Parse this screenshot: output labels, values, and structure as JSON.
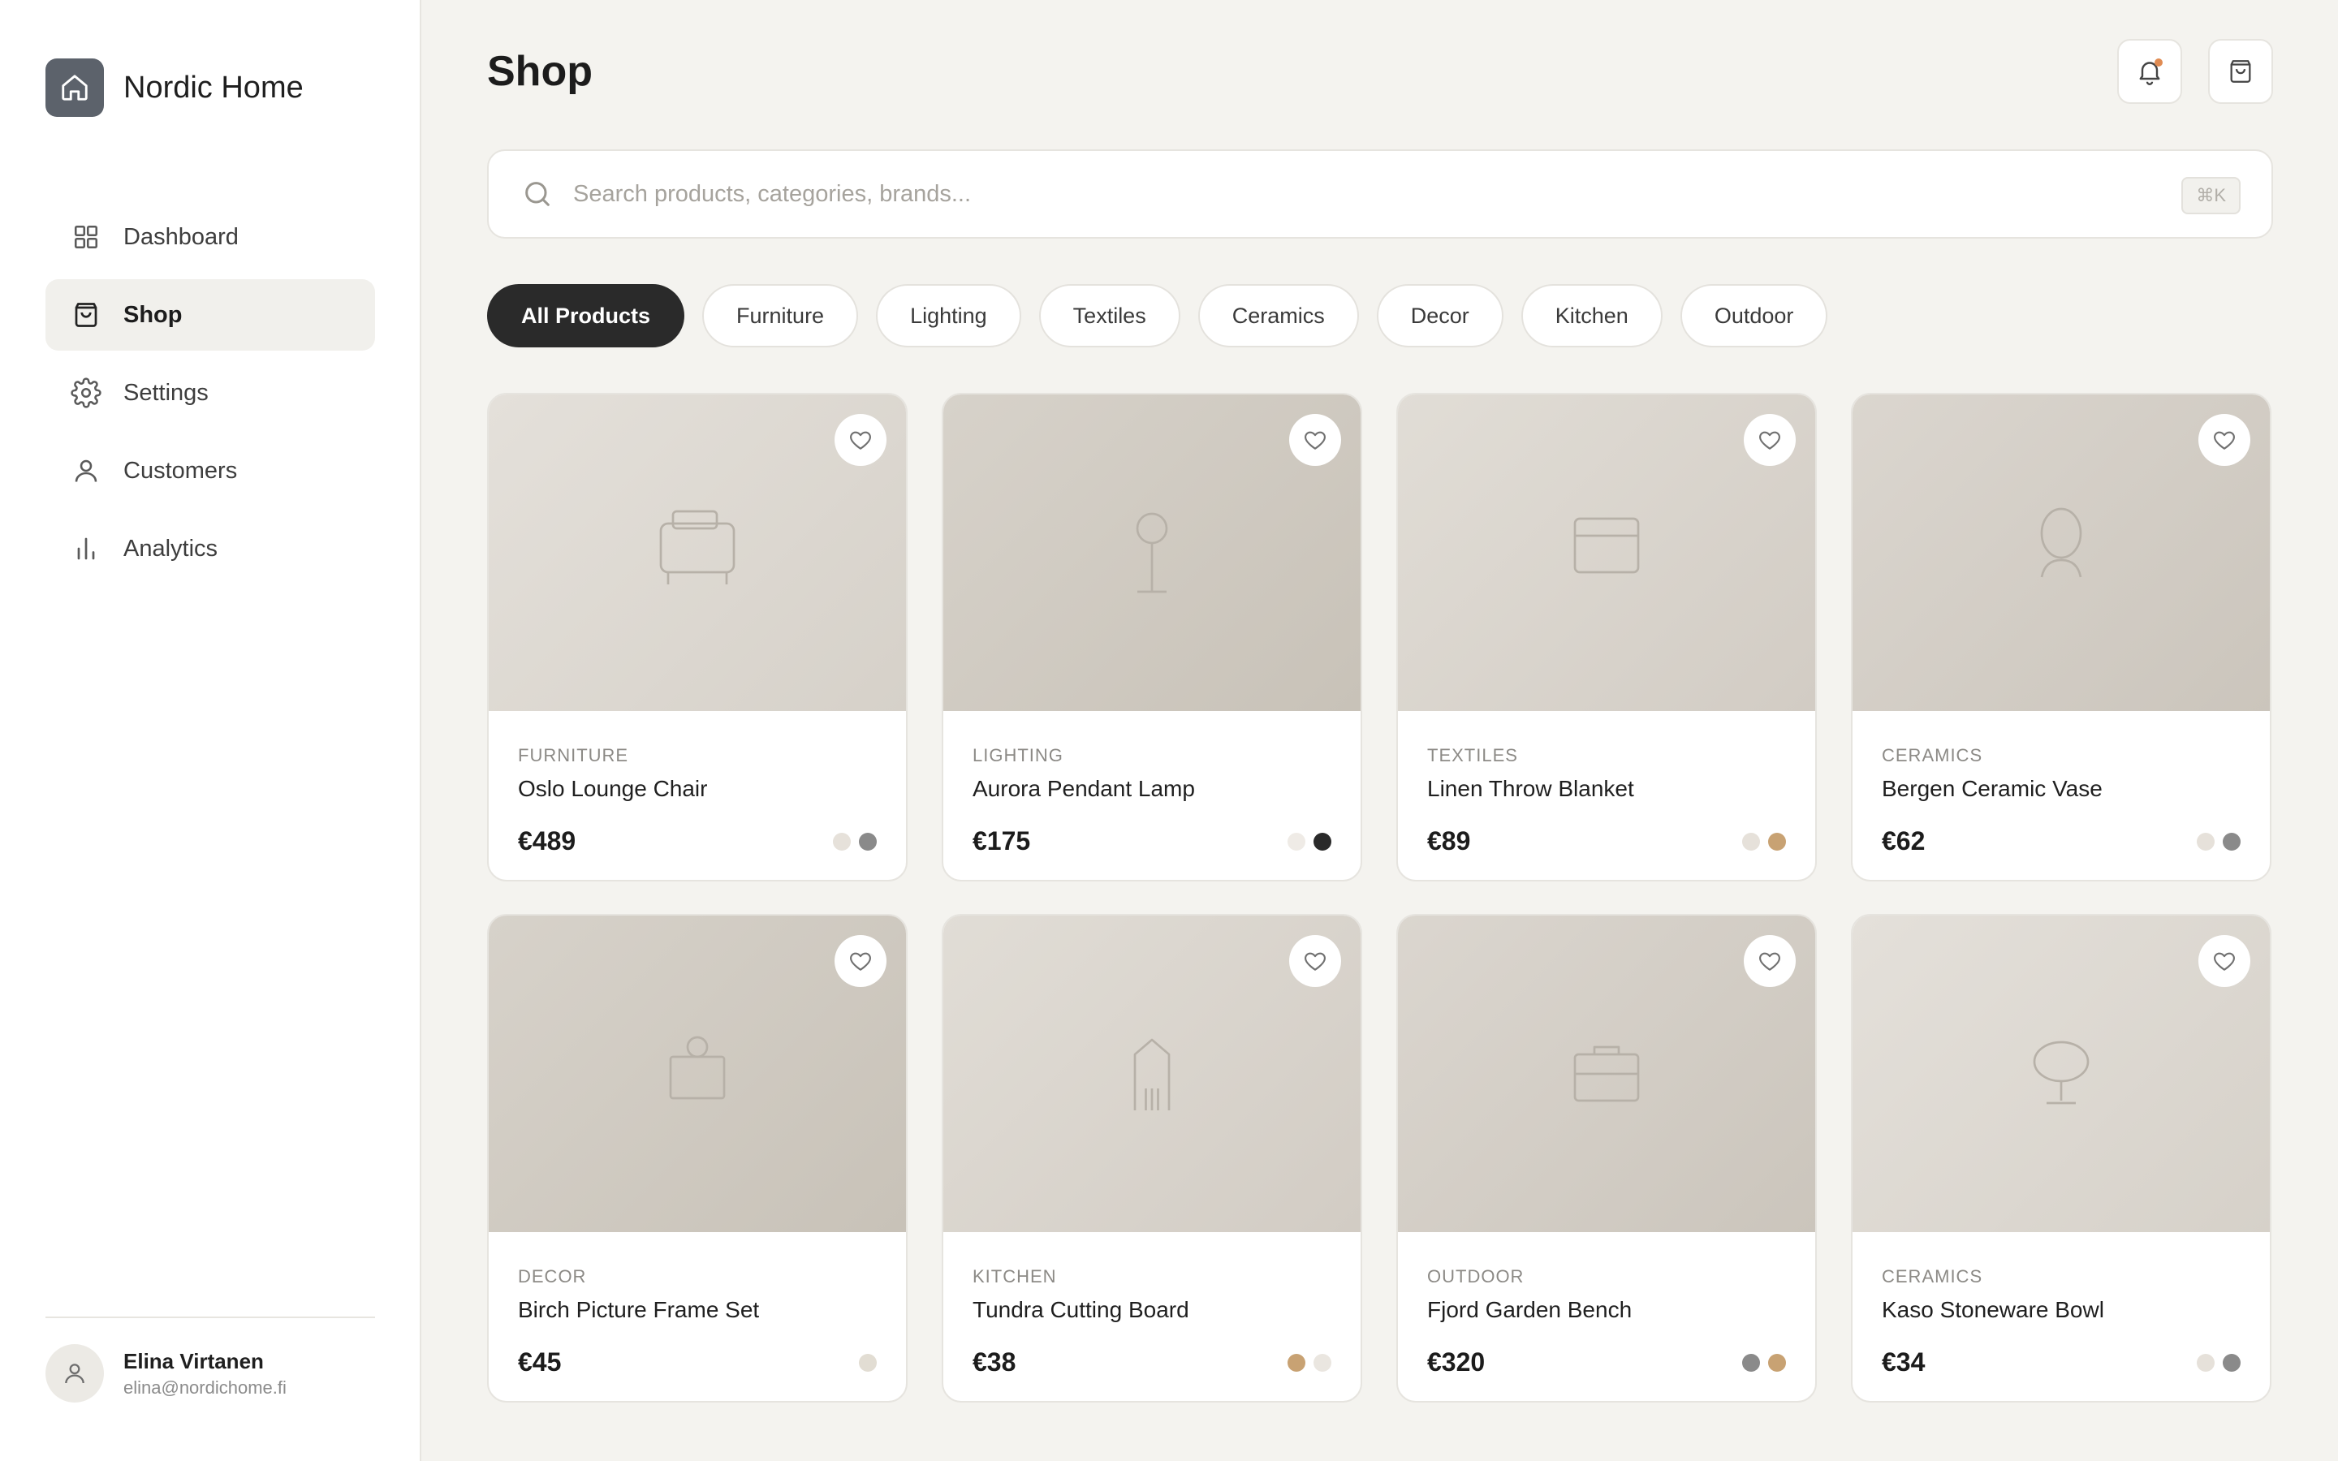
{
  "brand": {
    "name": "Nordic Home",
    "icon": "home-icon"
  },
  "nav": [
    {
      "label": "Dashboard",
      "icon": "grid-icon",
      "active": false
    },
    {
      "label": "Shop",
      "icon": "shopping-bag-icon",
      "active": true
    },
    {
      "label": "Settings",
      "icon": "gear-icon",
      "active": false
    },
    {
      "label": "Customers",
      "icon": "user-icon",
      "active": false
    },
    {
      "label": "Analytics",
      "icon": "bar-chart-icon",
      "active": false
    }
  ],
  "user": {
    "name": "Elina Virtanen",
    "email": "elina@nordichome.fi"
  },
  "header": {
    "title": "Shop"
  },
  "search": {
    "placeholder": "Search products, categories, brands...",
    "shortcut": "⌘K"
  },
  "filters": [
    "All Products",
    "Furniture",
    "Lighting",
    "Textiles",
    "Ceramics",
    "Decor",
    "Kitchen",
    "Outdoor"
  ],
  "active_filter": "All Products",
  "products": [
    {
      "category": "FURNITURE",
      "name": "Oslo Lounge Chair",
      "price": "€489",
      "icon": "chair-icon",
      "swatches": [
        "#e6e1da",
        "#8a8a8a"
      ]
    },
    {
      "category": "LIGHTING",
      "name": "Aurora Pendant Lamp",
      "price": "€175",
      "icon": "lamp-icon",
      "swatches": [
        "#efebe6",
        "#2a2a2a"
      ]
    },
    {
      "category": "TEXTILES",
      "name": "Linen Throw Blanket",
      "price": "€89",
      "icon": "blanket-icon",
      "swatches": [
        "#e6e1da",
        "#c8a273"
      ]
    },
    {
      "category": "CERAMICS",
      "name": "Bergen Ceramic Vase",
      "price": "€62",
      "icon": "vase-icon",
      "swatches": [
        "#e6e1da",
        "#8a8a8a"
      ]
    },
    {
      "category": "DECOR",
      "name": "Birch Picture Frame Set",
      "price": "€45",
      "icon": "frame-icon",
      "swatches": [
        "#e2ddd3"
      ]
    },
    {
      "category": "KITCHEN",
      "name": "Tundra Cutting Board",
      "price": "€38",
      "icon": "cutting-board-icon",
      "swatches": [
        "#c8a273",
        "#eae6e0"
      ]
    },
    {
      "category": "OUTDOOR",
      "name": "Fjord Garden Bench",
      "price": "€320",
      "icon": "bench-icon",
      "swatches": [
        "#8a8a8a",
        "#c8a273"
      ]
    },
    {
      "category": "CERAMICS",
      "name": "Kaso Stoneware Bowl",
      "price": "€34",
      "icon": "bowl-icon",
      "swatches": [
        "#e6e1da",
        "#8a8a8a"
      ]
    }
  ],
  "colors": {
    "accent_dark": "#2a2a2a",
    "notification_dot": "#e08b52",
    "brand_logo_bg": "#5c626b"
  }
}
